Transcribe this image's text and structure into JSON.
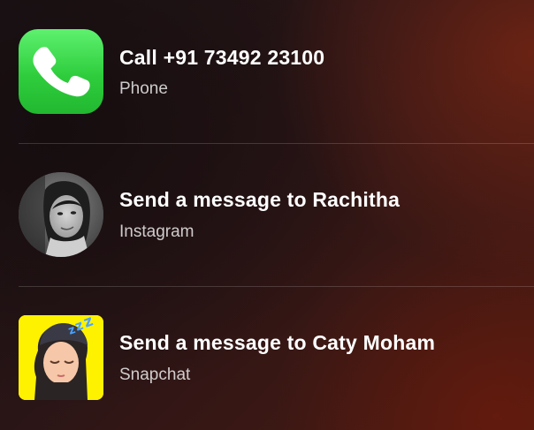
{
  "suggestions": [
    {
      "title": "Call +91 73492 23100",
      "subtitle": "Phone",
      "icon": "phone-app-icon",
      "icon_color": "#34c759"
    },
    {
      "title": "Send a message to Rachitha",
      "subtitle": "Instagram",
      "icon": "contact-avatar-photo"
    },
    {
      "title": "Send a message to Caty Moham",
      "subtitle": "Snapchat",
      "icon": "snapchat-bitmoji-avatar",
      "icon_color": "#fff200"
    }
  ],
  "colors": {
    "background_dark": "#1c1416",
    "background_warm": "#4a1a12",
    "divider": "rgba(255,255,255,0.16)"
  }
}
